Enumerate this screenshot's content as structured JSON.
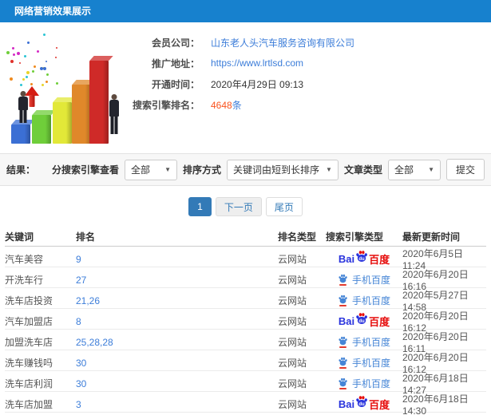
{
  "header": {
    "title": "网络营销效果展示"
  },
  "member": {
    "company_label": "会员公司：",
    "company_value": "山东老人头汽车服务咨询有限公司",
    "url_label": "推广地址：",
    "url_value": "https://www.lrtlsd.com",
    "opened_label": "开通时间：",
    "opened_value": "2020年4月29日 09:13",
    "rank_label": "搜索引擎排名：",
    "rank_count": "4648",
    "rank_unit": "条"
  },
  "filters": {
    "result_label": "结果：",
    "engine_label": "分搜索引擎查看",
    "engine_selected": "全部",
    "sort_label": "排序方式",
    "sort_selected": "关键词由短到长排序",
    "article_label": "文章类型",
    "article_selected": "全部",
    "submit_label": "提交"
  },
  "pagination": {
    "current": "1",
    "next": "下一页",
    "last": "尾页"
  },
  "table": {
    "headers": [
      "关键词",
      "排名",
      "排名类型",
      "搜索引擎类型",
      "最新更新时间"
    ],
    "rows": [
      {
        "keyword": "汽车美容",
        "rank": "9",
        "rank_type": "云网站",
        "engine": "baidu-pc",
        "updated": "2020年6月5日 11:24"
      },
      {
        "keyword": "开洗车行",
        "rank": "27",
        "rank_type": "云网站",
        "engine": "baidu-mobile",
        "updated": "2020年6月20日 16:16"
      },
      {
        "keyword": "洗车店投资",
        "rank": "21,26",
        "rank_type": "云网站",
        "engine": "baidu-mobile",
        "updated": "2020年5月27日 14:58"
      },
      {
        "keyword": "汽车加盟店",
        "rank": "8",
        "rank_type": "云网站",
        "engine": "baidu-pc",
        "updated": "2020年6月20日 16:12"
      },
      {
        "keyword": "加盟洗车店",
        "rank": "25,28,28",
        "rank_type": "云网站",
        "engine": "baidu-mobile",
        "updated": "2020年6月20日 16:11"
      },
      {
        "keyword": "洗车赚钱吗",
        "rank": "30",
        "rank_type": "云网站",
        "engine": "baidu-mobile",
        "updated": "2020年6月20日 16:12"
      },
      {
        "keyword": "洗车店利润",
        "rank": "30",
        "rank_type": "云网站",
        "engine": "baidu-mobile",
        "updated": "2020年6月18日 14:27"
      },
      {
        "keyword": "洗车店加盟",
        "rank": "3",
        "rank_type": "云网站",
        "engine": "baidu-pc",
        "updated": "2020年6月18日 14:30"
      }
    ]
  },
  "engine_logos": {
    "baidu_pc": {
      "bai": "Bai",
      "du": "du",
      "baidu": "百度"
    },
    "baidu_mobile": {
      "label": "手机百度"
    }
  },
  "illustration": {
    "bar_colors": [
      "#3b6fd4",
      "#6fce3a",
      "#e2e838",
      "#e0882a",
      "#cf2a28"
    ],
    "bar_heights": [
      24,
      36,
      52,
      74,
      104
    ],
    "confetti_palette": [
      "#e0312b",
      "#3b6fd4",
      "#6fce3a",
      "#e8d42a",
      "#d42ac4",
      "#2ac4d4",
      "#ef8a1e"
    ]
  },
  "colors": {
    "header_bg": "#1781ce",
    "link_blue": "#3c7dd9",
    "count_orange": "#f9531e",
    "active_page_blue": "#337ab7",
    "baidu_blue": "#2933dd",
    "baidu_red": "#e60b0a",
    "mobile_blue": "#4585d6"
  }
}
